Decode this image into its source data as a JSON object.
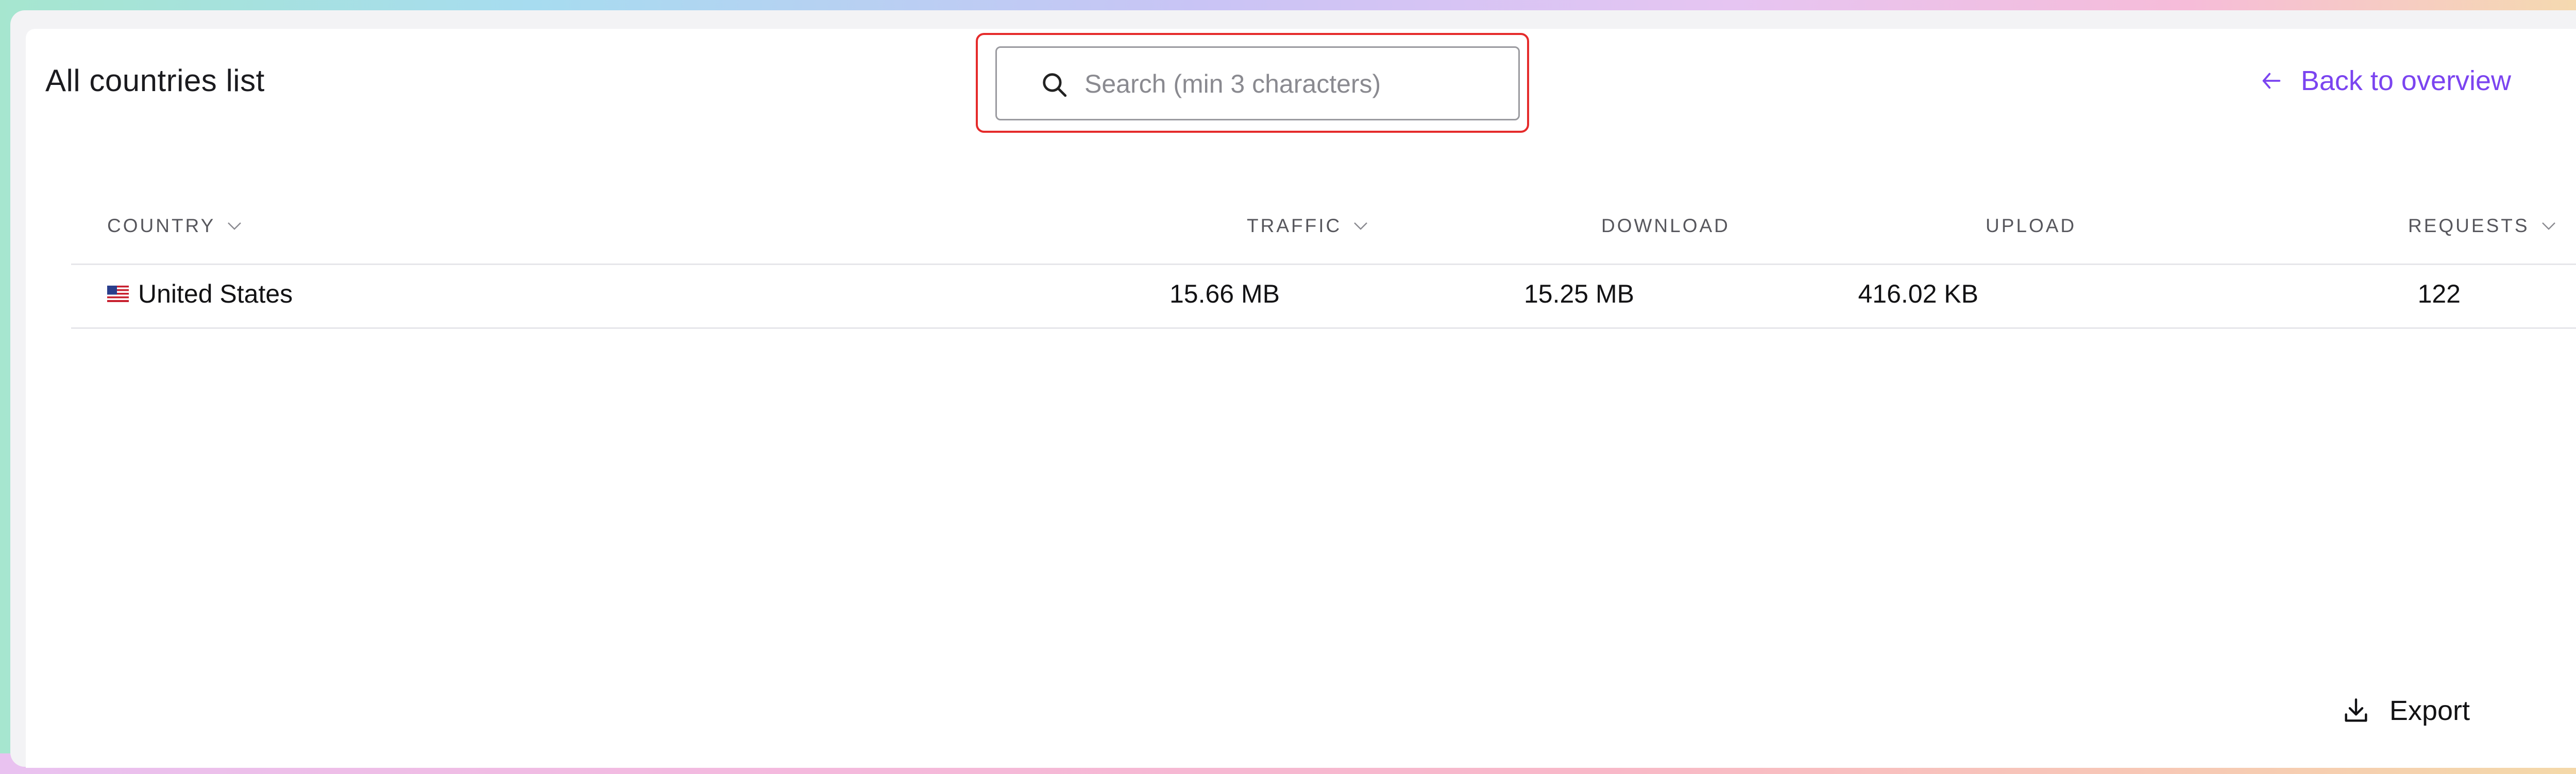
{
  "page": {
    "title": "All countries list",
    "back_link_label": "Back to overview",
    "export_label": "Export"
  },
  "search": {
    "placeholder": "Search (min 3 characters)",
    "value": ""
  },
  "table": {
    "columns": [
      {
        "label": "COUNTRY",
        "sortable": true
      },
      {
        "label": "TRAFFIC",
        "sortable": true
      },
      {
        "label": "DOWNLOAD",
        "sortable": false
      },
      {
        "label": "UPLOAD",
        "sortable": false
      },
      {
        "label": "REQUESTS",
        "sortable": true
      }
    ],
    "rows": [
      {
        "flag": "us-flag-icon",
        "country": "United States",
        "traffic": "15.66 MB",
        "download": "15.25 MB",
        "upload": "416.02 KB",
        "requests": "122"
      }
    ]
  },
  "colors": {
    "accent": "#7b44f0",
    "highlight": "#e52b2b"
  }
}
